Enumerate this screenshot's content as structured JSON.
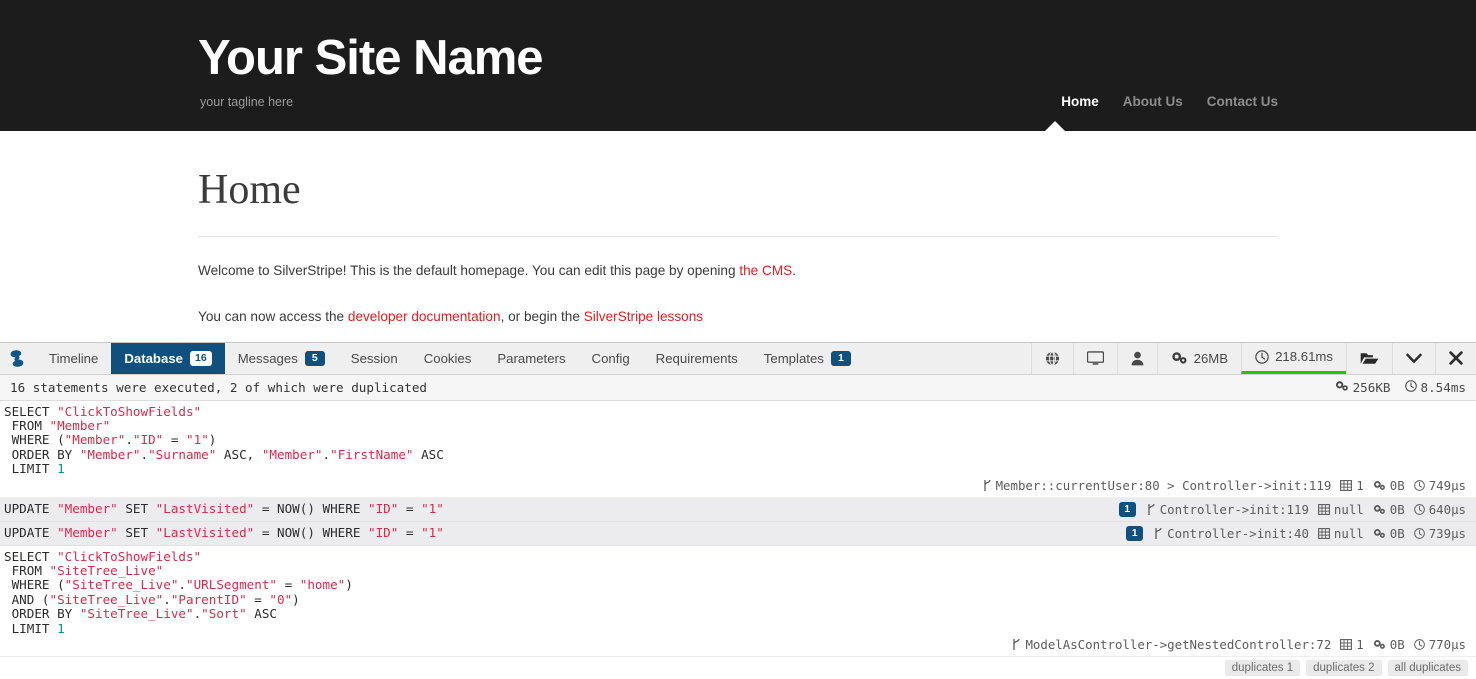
{
  "site": {
    "title": "Your Site Name",
    "tagline": "your tagline here",
    "nav": [
      {
        "label": "Home",
        "active": true
      },
      {
        "label": "About Us",
        "active": false
      },
      {
        "label": "Contact Us",
        "active": false
      }
    ]
  },
  "page": {
    "heading": "Home",
    "paragraph1_part1": "Welcome to SilverStripe! This is the default homepage. You can edit this page by opening ",
    "paragraph1_link": "the CMS",
    "paragraph1_part2": ".",
    "paragraph2_part1": "You can now access the ",
    "paragraph2_link1": "developer documentation",
    "paragraph2_part2": ", or begin the ",
    "paragraph2_link2": "SilverStripe lessons"
  },
  "debugbar": {
    "logo_icon": "silverstripe-logo-icon",
    "tabs": [
      {
        "label": "Timeline",
        "badge": null,
        "active": false
      },
      {
        "label": "Database",
        "badge": "16",
        "active": true
      },
      {
        "label": "Messages",
        "badge": "5",
        "active": false
      },
      {
        "label": "Session",
        "badge": null,
        "active": false
      },
      {
        "label": "Cookies",
        "badge": null,
        "active": false
      },
      {
        "label": "Parameters",
        "badge": null,
        "active": false
      },
      {
        "label": "Config",
        "badge": null,
        "active": false
      },
      {
        "label": "Requirements",
        "badge": null,
        "active": false
      },
      {
        "label": "Templates",
        "badge": "1",
        "active": false
      }
    ],
    "tools": [
      {
        "name": "globe-icon",
        "label": ""
      },
      {
        "name": "monitor-icon",
        "label": ""
      },
      {
        "name": "user-icon",
        "label": ""
      },
      {
        "name": "gears-icon",
        "label": "26MB"
      },
      {
        "name": "clock-icon",
        "label": "218.61ms"
      },
      {
        "name": "folder-open-icon",
        "label": ""
      },
      {
        "name": "chevron-down-icon",
        "label": ""
      },
      {
        "name": "close-icon",
        "label": ""
      }
    ],
    "summary": {
      "text": "16 statements were executed, 2 of which were duplicated",
      "memory": "256KB",
      "time": "8.54ms"
    },
    "queries": [
      {
        "id": "query-1",
        "duplicate_flag": null,
        "alt": false,
        "inline": false,
        "sql_lines": [
          [
            {
              "t": "k",
              "v": "SELECT "
            },
            {
              "t": "s",
              "v": "\"ClickToShowFields\""
            }
          ],
          [
            {
              "t": "k",
              "v": " FROM "
            },
            {
              "t": "s",
              "v": "\"Member\""
            }
          ],
          [
            {
              "t": "k",
              "v": " WHERE ("
            },
            {
              "t": "s",
              "v": "\"Member\""
            },
            {
              "t": "k",
              "v": "."
            },
            {
              "t": "s",
              "v": "\"ID\""
            },
            {
              "t": "k",
              "v": " = "
            },
            {
              "t": "s",
              "v": "\"1\""
            },
            {
              "t": "k",
              "v": ")"
            }
          ],
          [
            {
              "t": "k",
              "v": " ORDER BY "
            },
            {
              "t": "s",
              "v": "\"Member\""
            },
            {
              "t": "k",
              "v": "."
            },
            {
              "t": "s",
              "v": "\"Surname\""
            },
            {
              "t": "k",
              "v": " ASC, "
            },
            {
              "t": "s",
              "v": "\"Member\""
            },
            {
              "t": "k",
              "v": "."
            },
            {
              "t": "s",
              "v": "\"FirstName\""
            },
            {
              "t": "k",
              "v": " ASC"
            }
          ],
          [
            {
              "t": "k",
              "v": " LIMIT "
            },
            {
              "t": "n",
              "v": "1"
            }
          ]
        ],
        "source": "Member::currentUser:80 > Controller->init:119",
        "rows": "1",
        "memory": "0B",
        "time": "749µs"
      },
      {
        "id": "query-2",
        "duplicate_flag": "1",
        "alt": true,
        "inline": true,
        "sql_lines": [
          [
            {
              "t": "k",
              "v": "UPDATE "
            },
            {
              "t": "s",
              "v": "\"Member\""
            },
            {
              "t": "k",
              "v": " SET "
            },
            {
              "t": "s",
              "v": "\"LastVisited\""
            },
            {
              "t": "k",
              "v": " = NOW() WHERE "
            },
            {
              "t": "s",
              "v": "\"ID\""
            },
            {
              "t": "k",
              "v": " = "
            },
            {
              "t": "s",
              "v": "\"1\""
            }
          ]
        ],
        "source": "Controller->init:119",
        "rows": "null",
        "memory": "0B",
        "time": "640µs"
      },
      {
        "id": "query-3",
        "duplicate_flag": "1",
        "alt": true,
        "inline": true,
        "sql_lines": [
          [
            {
              "t": "k",
              "v": "UPDATE "
            },
            {
              "t": "s",
              "v": "\"Member\""
            },
            {
              "t": "k",
              "v": " SET "
            },
            {
              "t": "s",
              "v": "\"LastVisited\""
            },
            {
              "t": "k",
              "v": " = NOW() WHERE "
            },
            {
              "t": "s",
              "v": "\"ID\""
            },
            {
              "t": "k",
              "v": " = "
            },
            {
              "t": "s",
              "v": "\"1\""
            }
          ]
        ],
        "source": "Controller->init:40",
        "rows": "null",
        "memory": "0B",
        "time": "739µs"
      },
      {
        "id": "query-4",
        "duplicate_flag": null,
        "alt": false,
        "inline": false,
        "sql_lines": [
          [
            {
              "t": "k",
              "v": "SELECT "
            },
            {
              "t": "s",
              "v": "\"ClickToShowFields\""
            }
          ],
          [
            {
              "t": "k",
              "v": " FROM "
            },
            {
              "t": "s",
              "v": "\"SiteTree_Live\""
            }
          ],
          [
            {
              "t": "k",
              "v": " WHERE ("
            },
            {
              "t": "s",
              "v": "\"SiteTree_Live\""
            },
            {
              "t": "k",
              "v": "."
            },
            {
              "t": "s",
              "v": "\"URLSegment\""
            },
            {
              "t": "k",
              "v": " = "
            },
            {
              "t": "s",
              "v": "\"home\""
            },
            {
              "t": "k",
              "v": ")"
            }
          ],
          [
            {
              "t": "k",
              "v": " AND ("
            },
            {
              "t": "s",
              "v": "\"SiteTree_Live\""
            },
            {
              "t": "k",
              "v": "."
            },
            {
              "t": "s",
              "v": "\"ParentID\""
            },
            {
              "t": "k",
              "v": " = "
            },
            {
              "t": "s",
              "v": "\"0\""
            },
            {
              "t": "k",
              "v": ")"
            }
          ],
          [
            {
              "t": "k",
              "v": " ORDER BY "
            },
            {
              "t": "s",
              "v": "\"SiteTree_Live\""
            },
            {
              "t": "k",
              "v": "."
            },
            {
              "t": "s",
              "v": "\"Sort\""
            },
            {
              "t": "k",
              "v": " ASC"
            }
          ],
          [
            {
              "t": "k",
              "v": " LIMIT "
            },
            {
              "t": "n",
              "v": "1"
            }
          ]
        ],
        "source": "ModelAsController->getNestedController:72",
        "rows": "1",
        "memory": "0B",
        "time": "770µs"
      }
    ],
    "footer_chips": [
      "duplicates 1",
      "duplicates 2",
      "all duplicates"
    ]
  },
  "colors": {
    "accent": "#10507f",
    "link": "#e02020",
    "header_bg": "#1c1c1c",
    "timing_green": "#2fbf00"
  }
}
